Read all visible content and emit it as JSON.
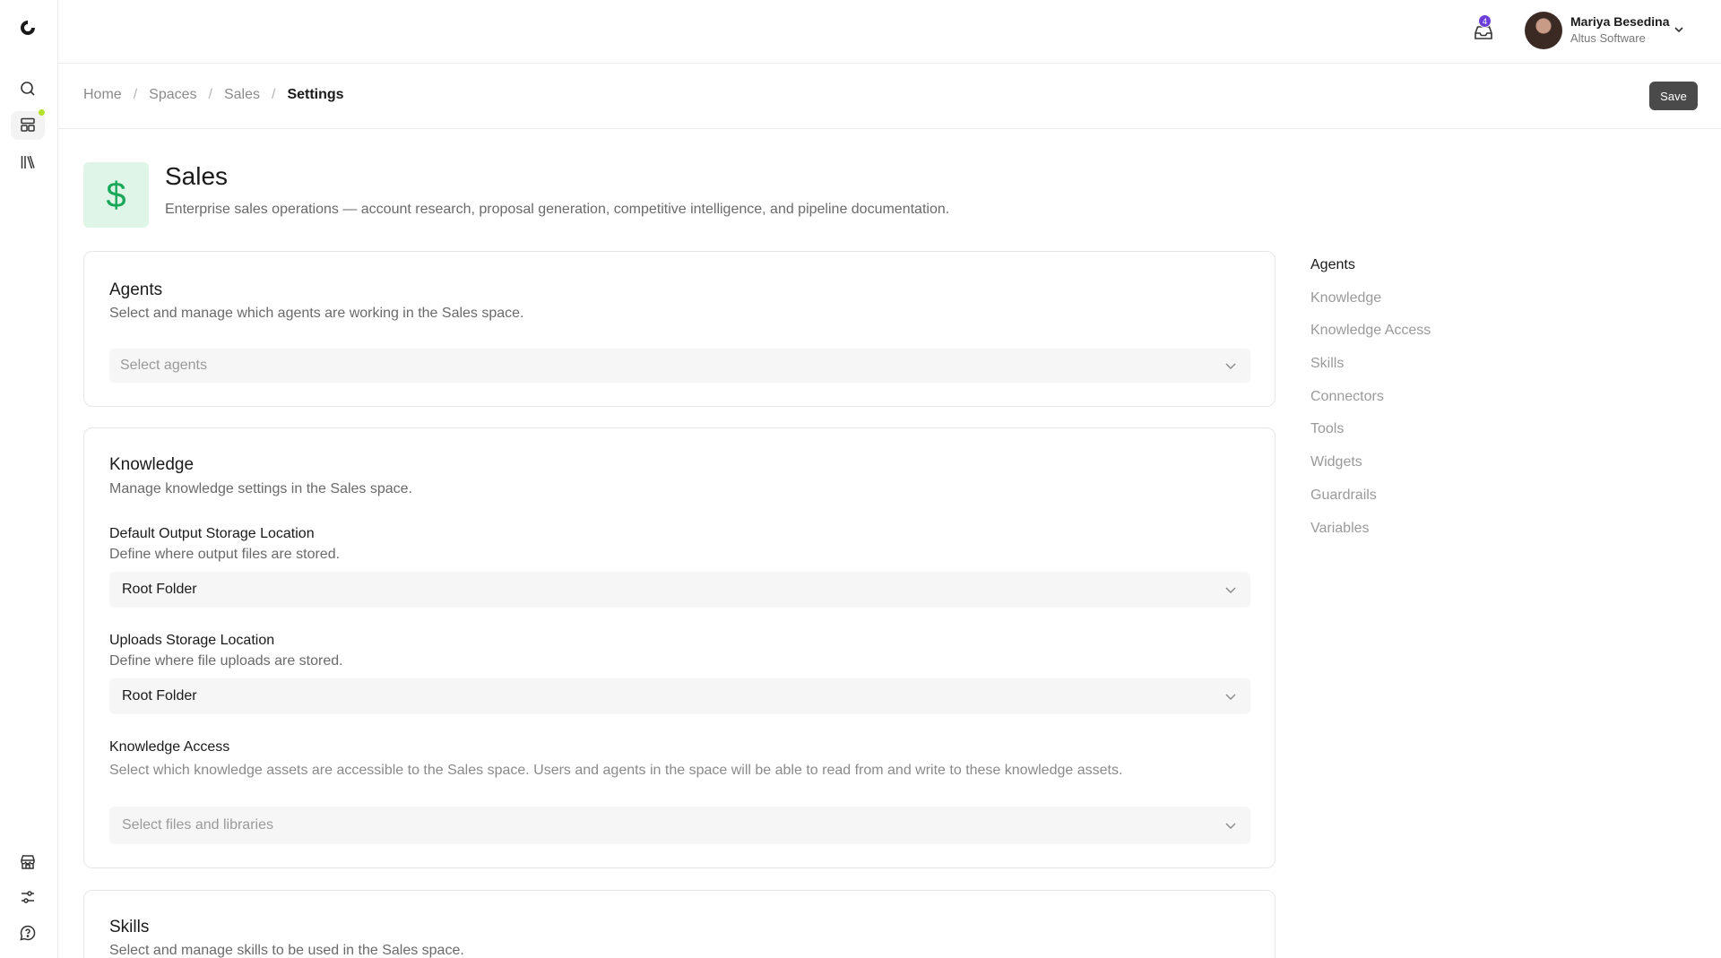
{
  "topbar": {
    "inbox_badge": "4",
    "user_name": "Mariya Besedina",
    "user_org": "Altus Software"
  },
  "breadcrumb": [
    "Home",
    "Spaces",
    "Sales",
    "Settings"
  ],
  "toolbar": {
    "save_label": "Save"
  },
  "space": {
    "icon": "dollar-icon",
    "icon_glyph": "$",
    "title": "Sales",
    "description": "Enterprise sales operations — account research, proposal generation, competitive intelligence, and pipeline documentation."
  },
  "agents": {
    "title": "Agents",
    "subtitle": "Select and manage which agents are working in the Sales space.",
    "select_placeholder": "Select agents"
  },
  "knowledge": {
    "title": "Knowledge",
    "subtitle": "Manage knowledge settings in the Sales space.",
    "output_label": "Default Output Storage Location",
    "output_help": "Define where output files are stored.",
    "output_value": "Root Folder",
    "uploads_label": "Uploads Storage Location",
    "uploads_help": "Define where file uploads are stored.",
    "uploads_value": "Root Folder",
    "access_label": "Knowledge Access",
    "access_help": "Select which knowledge assets are accessible to the Sales space. Users and agents in the space will be able to read from and write to these knowledge assets.",
    "access_placeholder": "Select files and libraries"
  },
  "skills": {
    "title": "Skills",
    "subtitle": "Select and manage skills to be used in the Sales space."
  },
  "sidenav": {
    "items": [
      {
        "label": "Agents"
      },
      {
        "label": "Knowledge"
      },
      {
        "label": "Knowledge Access"
      },
      {
        "label": "Skills"
      },
      {
        "label": "Connectors"
      },
      {
        "label": "Tools"
      },
      {
        "label": "Widgets"
      },
      {
        "label": "Guardrails"
      },
      {
        "label": "Variables"
      }
    ]
  },
  "colors": {
    "accent_green": "#19a85a",
    "badge_purple": "#6c3fd8",
    "status_dot": "#b6e12b",
    "save_button": "#4a4a4a"
  }
}
